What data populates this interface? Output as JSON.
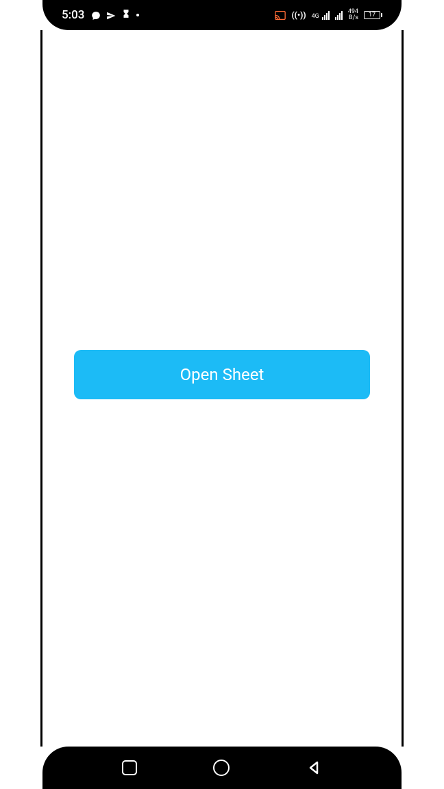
{
  "statusBar": {
    "time": "5:03",
    "networkType": "4G",
    "dataRate": "494",
    "dataUnit": "B/s",
    "batteryLevel": "17"
  },
  "main": {
    "openSheetLabel": "Open Sheet"
  }
}
